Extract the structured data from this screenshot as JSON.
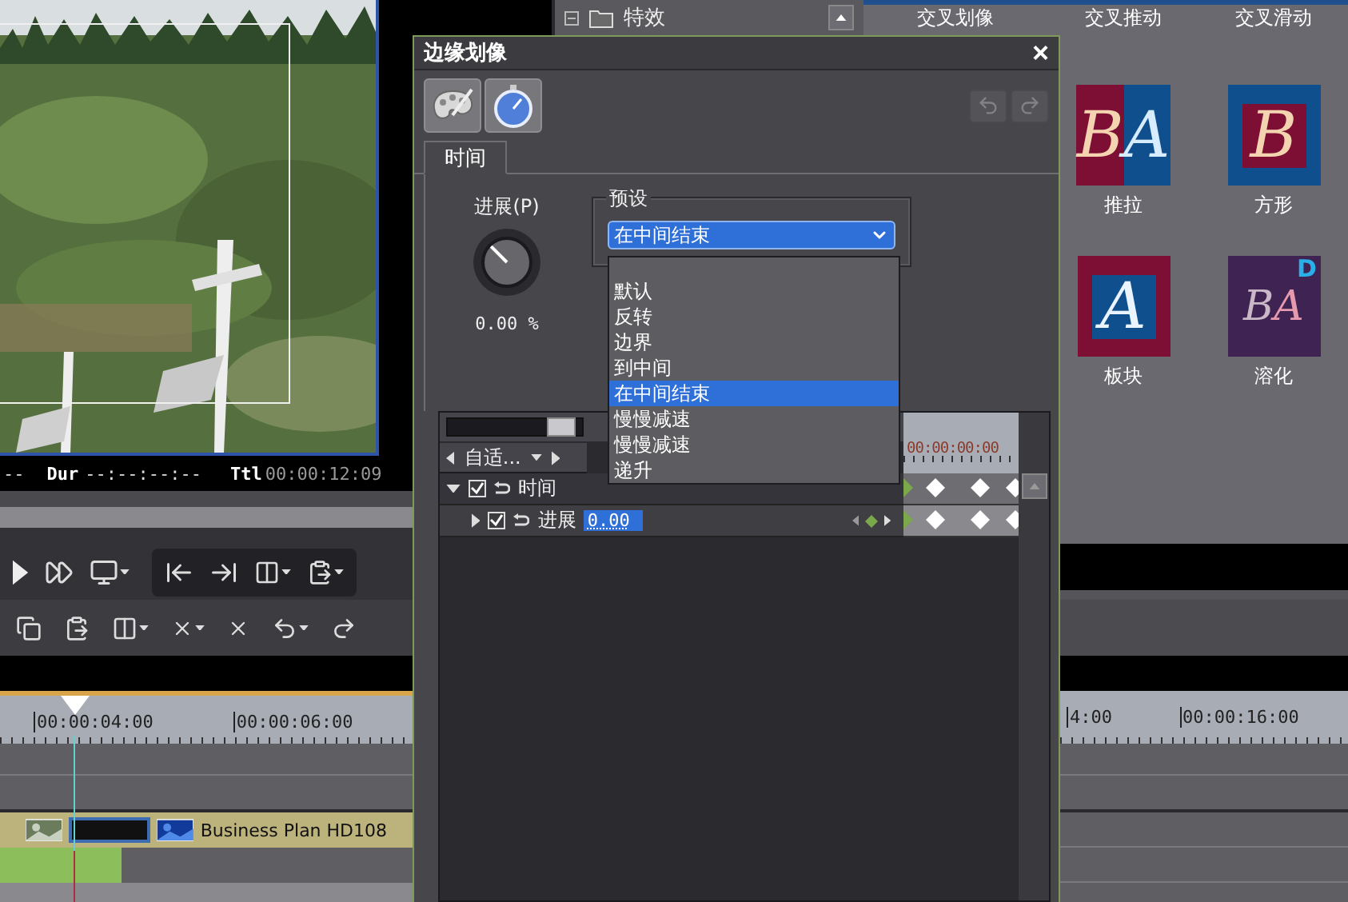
{
  "timecode": {
    "lead": "--",
    "dur_label": "Dur",
    "dur": "--:--:--:--",
    "ttl_label": "Ttl",
    "ttl": "00:00:12:09"
  },
  "effects_tree": {
    "label": "特效",
    "expanded": true
  },
  "palette": {
    "top_labels": [
      "交叉划像",
      "交叉推动",
      "交叉滑动"
    ],
    "rows": [
      [
        {
          "label": "推拉",
          "kind": "push",
          "letters": [
            "B",
            "A"
          ]
        },
        {
          "label": "方形",
          "kind": "square",
          "letters": [
            "B"
          ]
        }
      ],
      [
        {
          "label": "板块",
          "kind": "block",
          "letters": [
            "A"
          ]
        },
        {
          "label": "溶化",
          "kind": "dissolve",
          "letters": [
            "B",
            "A"
          ],
          "badge": "D"
        }
      ]
    ]
  },
  "dialog": {
    "title": "边缘划像",
    "close": "×",
    "tools": [
      {
        "kind": "palette"
      },
      {
        "kind": "stopwatch"
      }
    ],
    "history": [
      {
        "kind": "undo",
        "disabled": true
      },
      {
        "kind": "redo",
        "disabled": true
      }
    ],
    "tabs": [
      {
        "label": "时间",
        "selected": true
      }
    ],
    "progress": {
      "label": "进展(P)",
      "level": 0,
      "value": "0.00 %"
    },
    "preset": {
      "legend": "预设",
      "value": "在中间结束",
      "open": true,
      "options": [
        {
          "label": "默认",
          "selected": false
        },
        {
          "label": "反转",
          "selected": false
        },
        {
          "label": "边界",
          "selected": false
        },
        {
          "label": "到中间",
          "selected": false
        },
        {
          "label": "在中间结束",
          "selected": true
        },
        {
          "label": "慢慢减速",
          "selected": false
        },
        {
          "label": "慢慢减速",
          "selected": false
        },
        {
          "label": "递升",
          "selected": false
        }
      ]
    },
    "timeline": {
      "zoom": {
        "level": 0.85
      },
      "fit_label": "自适...",
      "ruler": "00:00:00:00",
      "tracks": [
        {
          "label": "时间",
          "checked": true,
          "expanded": true,
          "children": [
            {
              "label": "进展",
              "checked": true,
              "expanded": false,
              "value": "0.00"
            }
          ]
        }
      ]
    }
  },
  "timeline": {
    "ruler_left": [
      "00:00:04:00",
      "00:00:06:00"
    ],
    "ruler_right": [
      "4:00",
      "00:00:16:00"
    ],
    "clip": {
      "title": "Business Plan HD108"
    }
  }
}
